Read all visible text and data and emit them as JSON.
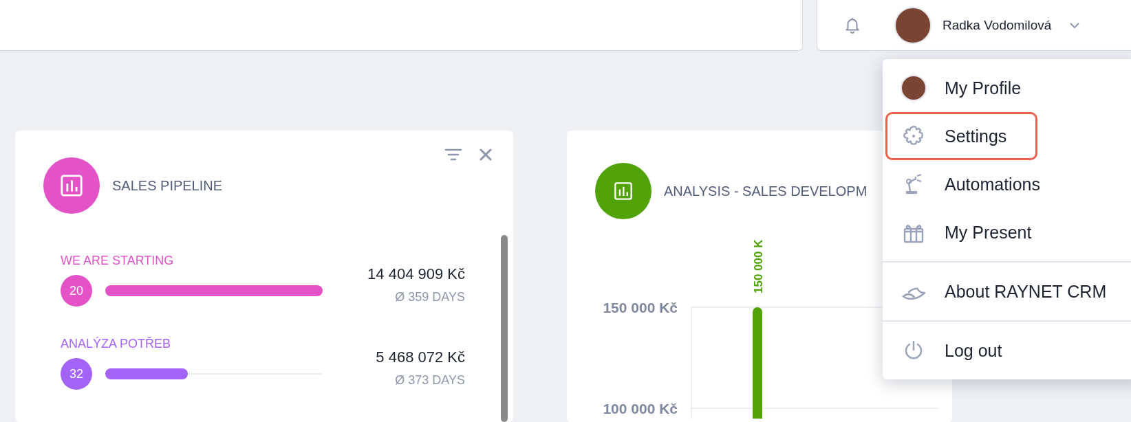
{
  "header": {
    "user_name": "Radka Vodomilová"
  },
  "pipeline_card": {
    "title": "SALES PIPELINE",
    "stages": [
      {
        "name": "WE ARE STARTING",
        "count": "20",
        "level": 1,
        "amount": "14 404 909 Kč",
        "avg_days": "Ø 359 DAYS",
        "color": "#e352c6"
      },
      {
        "name": "ANALÝZA POTŘEB",
        "count": "32",
        "level": 0.38,
        "amount": "5 468 072 Kč",
        "avg_days": "Ø 373 DAYS",
        "color": "#a463f7"
      }
    ]
  },
  "analysis_card": {
    "title": "ANALYSIS - SALES DEVELOPM",
    "chart_data": {
      "type": "bar",
      "values": [
        150000
      ],
      "ylim": [
        95000,
        150000
      ],
      "yticks": [
        {
          "value": 100000,
          "label": "100 000 Kč"
        },
        {
          "value": 150000,
          "label": "150 000 Kč"
        }
      ],
      "value_labels": [
        "150 000 K"
      ]
    }
  },
  "user_menu": {
    "sections": [
      [
        {
          "kind": "avatar",
          "label": "My Profile",
          "selected": false
        },
        {
          "kind": "gear",
          "label": "Settings",
          "selected": true
        },
        {
          "kind": "robot",
          "label": "Automations",
          "selected": false
        },
        {
          "kind": "gift",
          "label": "My Present",
          "selected": false
        }
      ],
      [
        {
          "kind": "logo",
          "label": "About RAYNET CRM",
          "selected": false
        }
      ],
      [
        {
          "kind": "power",
          "label": "Log out",
          "selected": false
        }
      ]
    ]
  }
}
